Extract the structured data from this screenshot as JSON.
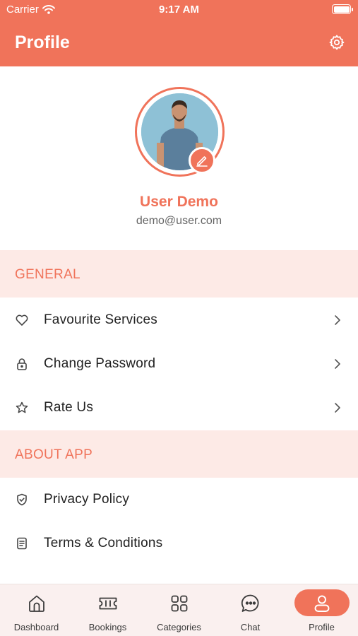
{
  "status_bar": {
    "carrier": "Carrier",
    "time": "9:17 AM"
  },
  "header": {
    "title": "Profile",
    "settings_icon": "gear-icon"
  },
  "profile": {
    "name": "User Demo",
    "email": "demo@user.com"
  },
  "sections": {
    "general": {
      "title": "GENERAL",
      "items": [
        {
          "label": "Favourite Services",
          "icon": "heart-icon"
        },
        {
          "label": "Change Password",
          "icon": "lock-icon"
        },
        {
          "label": "Rate Us",
          "icon": "star-icon"
        }
      ]
    },
    "about": {
      "title": "ABOUT APP",
      "items": [
        {
          "label": "Privacy Policy",
          "icon": "shield-check-icon"
        },
        {
          "label": "Terms & Conditions",
          "icon": "document-icon"
        }
      ]
    }
  },
  "tabs": [
    {
      "label": "Dashboard",
      "icon": "home-icon"
    },
    {
      "label": "Bookings",
      "icon": "ticket-icon"
    },
    {
      "label": "Categories",
      "icon": "grid-icon"
    },
    {
      "label": "Chat",
      "icon": "chat-icon"
    },
    {
      "label": "Profile",
      "icon": "user-icon",
      "active": true
    }
  ],
  "colors": {
    "accent": "#f0735a",
    "section_bg": "#fdeae6",
    "tabbar_bg": "#faf0ef"
  }
}
